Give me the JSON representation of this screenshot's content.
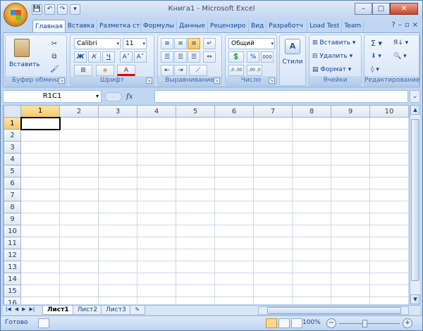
{
  "window": {
    "title": "Книга1 - Microsoft Excel",
    "controls": {
      "minimize": "–",
      "maximize": "□",
      "close": "✕"
    }
  },
  "qat": [
    "💾",
    "↶",
    "↷",
    "▾"
  ],
  "tabs": [
    {
      "label": "Главная",
      "active": true
    },
    {
      "label": "Вставка"
    },
    {
      "label": "Разметка ст"
    },
    {
      "label": "Формулы"
    },
    {
      "label": "Данные"
    },
    {
      "label": "Рецензиро"
    },
    {
      "label": "Вид"
    },
    {
      "label": "Разработч"
    },
    {
      "label": "Load Test"
    },
    {
      "label": "Team"
    }
  ],
  "ribbon_ctrls": {
    "help": "?",
    "minimize": "–",
    "restore": "▫",
    "close": "×"
  },
  "ribbon": {
    "clipboard": {
      "label": "Буфер обмена",
      "paste": "Вставить"
    },
    "font": {
      "label": "Шрифт",
      "name": "Calibri",
      "size": "11",
      "bold": "Ж",
      "italic": "К",
      "underline": "Ч",
      "grow": "A˄",
      "shrink": "A˅",
      "borders": "⊞",
      "fill": "◈",
      "fontcolor": "A"
    },
    "alignment": {
      "label": "Выравнивание"
    },
    "number": {
      "label": "Число",
      "format": "Общий",
      "percent": "%",
      "thousands": "000",
      "inc_dec": ",0 ,00",
      "dec_dec": ",00 ,0"
    },
    "styles": {
      "label": "Стили"
    },
    "cells": {
      "label": "Ячейки",
      "insert": "Вставить",
      "delete": "Удалить",
      "format": "Формат"
    },
    "editing": {
      "label": "Редактирование",
      "sum": "Σ",
      "sort": "Я↓",
      "find": "🔍",
      "clear": "◊"
    }
  },
  "formula_bar": {
    "name_box": "R1C1",
    "fx": "fx",
    "formula": ""
  },
  "grid": {
    "columns": [
      "1",
      "2",
      "3",
      "4",
      "5",
      "6",
      "7",
      "8",
      "9",
      "10"
    ],
    "rows": [
      "1",
      "2",
      "3",
      "4",
      "5",
      "6",
      "7",
      "8",
      "9",
      "10",
      "11",
      "12",
      "13",
      "14",
      "15",
      "16"
    ]
  },
  "sheets": [
    {
      "label": "Лист1",
      "active": true
    },
    {
      "label": "Лист2"
    },
    {
      "label": "Лист3"
    }
  ],
  "status": {
    "text": "Готово",
    "zoom": "100%",
    "zoom_minus": "−",
    "zoom_plus": "+"
  }
}
